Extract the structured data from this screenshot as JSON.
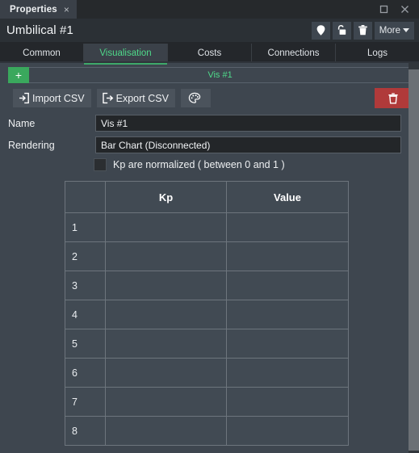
{
  "window": {
    "doc_tab_label": "Properties",
    "tab_close_glyph": "×",
    "maximize_name": "maximize-button",
    "close_name": "close-button"
  },
  "header": {
    "title": "Umbilical #1",
    "more_label": "More",
    "actions": [
      {
        "name": "pin-icon",
        "title": "Pin"
      },
      {
        "name": "unlock-icon",
        "title": "Unlocked"
      },
      {
        "name": "trash-icon",
        "title": "Delete"
      }
    ]
  },
  "tabs": [
    {
      "label": "Common",
      "active": false
    },
    {
      "label": "Visualisation",
      "active": true
    },
    {
      "label": "Costs",
      "active": false
    },
    {
      "label": "Connections",
      "active": false
    },
    {
      "label": "Logs",
      "active": false
    }
  ],
  "subtabs": {
    "add_label": "+",
    "items": [
      {
        "label": "Vis #1",
        "active": true
      }
    ]
  },
  "toolbar": {
    "import_label": "Import CSV",
    "export_label": "Export CSV",
    "palette_label": "",
    "delete_label": ""
  },
  "form": {
    "name_label": "Name",
    "name_value": "Vis #1",
    "name_placeholder": "Name",
    "rendering_label": "Rendering",
    "rendering_value": "Bar Chart (Disconnected)",
    "rendering_placeholder": "Rendering",
    "normalized_label": "Kp are normalized ( between 0 and 1 )",
    "normalized_checked": false
  },
  "table": {
    "columns": [
      "",
      "Kp",
      "Value"
    ],
    "rows": [
      {
        "index": "1",
        "kp": "",
        "value": ""
      },
      {
        "index": "2",
        "kp": "",
        "value": ""
      },
      {
        "index": "3",
        "kp": "",
        "value": ""
      },
      {
        "index": "4",
        "kp": "",
        "value": ""
      },
      {
        "index": "5",
        "kp": "",
        "value": ""
      },
      {
        "index": "6",
        "kp": "",
        "value": ""
      },
      {
        "index": "7",
        "kp": "",
        "value": ""
      },
      {
        "index": "8",
        "kp": "",
        "value": ""
      }
    ]
  },
  "colors": {
    "panel_bg": "#3e464f",
    "titlebar_bg": "#26292c",
    "header_bg": "#2b3035",
    "tabbar_bg": "#24272b",
    "accent_green": "#4fd98a",
    "add_green": "#3aa85d",
    "delete_red": "#b03a3a",
    "input_bg": "#232629",
    "grid_line": "#6d757d",
    "scrollbar_thumb": "#6b7075"
  }
}
